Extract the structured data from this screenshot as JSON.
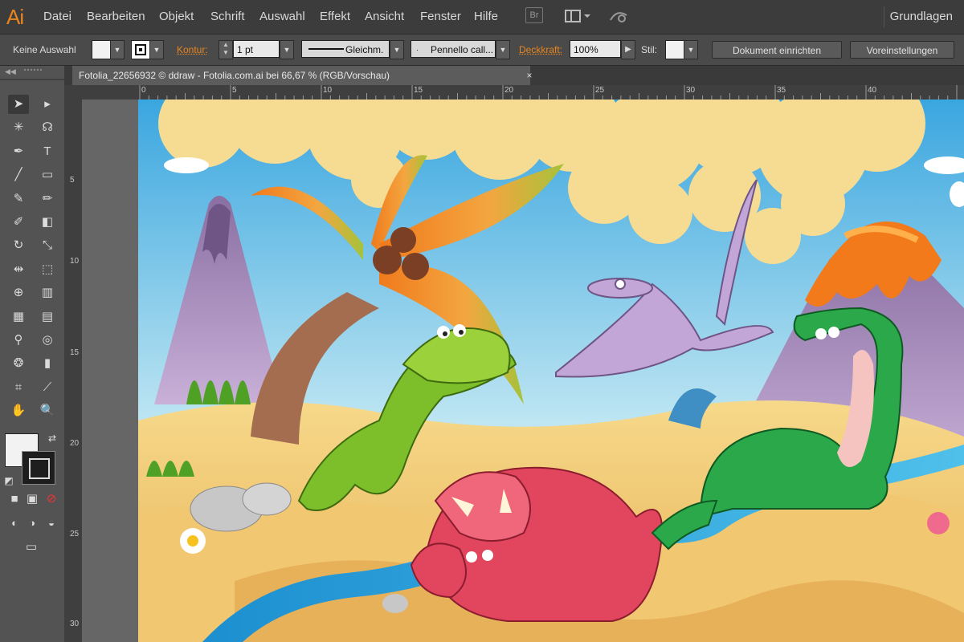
{
  "app": {
    "logo": "Ai"
  },
  "menu": {
    "items": [
      "Datei",
      "Bearbeiten",
      "Objekt",
      "Schrift",
      "Auswahl",
      "Effekt",
      "Ansicht",
      "Fenster",
      "Hilfe"
    ],
    "bridge_label": "Br",
    "workspace": "Grundlagen"
  },
  "control": {
    "selection_status": "Keine Auswahl",
    "stroke_label": "Kontur:",
    "stroke_weight": "1 pt",
    "profile": "Gleichm.",
    "brush": "Pennello call...",
    "opacity_label": "Deckkraft:",
    "opacity_value": "100%",
    "style_label": "Stil:",
    "doc_setup_button": "Dokument einrichten",
    "prefs_button": "Voreinstellungen"
  },
  "document": {
    "tab_title": "Fotolia_22656932 © ddraw - Fotolia.com.ai bei 66,67 % (RGB/Vorschau)",
    "close_glyph": "×"
  },
  "rulers": {
    "h_ticks": [
      "0",
      "5",
      "10",
      "15",
      "20",
      "25",
      "30",
      "35",
      "40"
    ],
    "v_ticks": [
      "5",
      "10",
      "15",
      "20",
      "25",
      "30"
    ]
  },
  "tools": [
    {
      "name": "selection-tool",
      "glyph": "➤"
    },
    {
      "name": "direct-selection-tool",
      "glyph": "▸"
    },
    {
      "name": "magic-wand-tool",
      "glyph": "✳"
    },
    {
      "name": "lasso-tool",
      "glyph": "☊"
    },
    {
      "name": "pen-tool",
      "glyph": "✒"
    },
    {
      "name": "type-tool",
      "glyph": "T"
    },
    {
      "name": "line-segment-tool",
      "glyph": "╱"
    },
    {
      "name": "rectangle-tool",
      "glyph": "▭"
    },
    {
      "name": "paintbrush-tool",
      "glyph": "✎"
    },
    {
      "name": "pencil-tool",
      "glyph": "✏"
    },
    {
      "name": "blob-brush-tool",
      "glyph": "✐"
    },
    {
      "name": "eraser-tool",
      "glyph": "◧"
    },
    {
      "name": "rotate-tool",
      "glyph": "↻"
    },
    {
      "name": "scale-tool",
      "glyph": "⤡"
    },
    {
      "name": "width-tool",
      "glyph": "⇹"
    },
    {
      "name": "free-transform-tool",
      "glyph": "⬚"
    },
    {
      "name": "shape-builder-tool",
      "glyph": "⊕"
    },
    {
      "name": "graph-tool",
      "glyph": "▥"
    },
    {
      "name": "mesh-tool",
      "glyph": "▦"
    },
    {
      "name": "gradient-tool",
      "glyph": "▤"
    },
    {
      "name": "eyedropper-tool",
      "glyph": "⚲"
    },
    {
      "name": "blend-tool",
      "glyph": "◎"
    },
    {
      "name": "symbol-sprayer-tool",
      "glyph": "❂"
    },
    {
      "name": "column-graph-tool",
      "glyph": "▮"
    },
    {
      "name": "artboard-tool",
      "glyph": "⌗"
    },
    {
      "name": "slice-tool",
      "glyph": "⟋"
    },
    {
      "name": "hand-tool",
      "glyph": "✋"
    },
    {
      "name": "zoom-tool",
      "glyph": "🔍"
    }
  ],
  "bottom_tools": {
    "swap_glyph": "⇄",
    "default_glyph": "◩",
    "color_mode_glyph": "■",
    "gradient_mode_glyph": "▣",
    "none_mode_glyph": "⊘",
    "draw_normal_glyph": "◐",
    "draw_behind_glyph": "◑",
    "draw_inside_glyph": "◒",
    "screen_mode_glyph": "▭"
  },
  "colors": {
    "accent": "#e8851f",
    "sky": "#58b8e0",
    "sand": "#f0c86a",
    "dino_green": "#7cbf2a",
    "dino_pink": "#e2465e",
    "dino_brachio": "#2aa84a",
    "volcano": "#b89ac6",
    "lava": "#f27a1a"
  }
}
